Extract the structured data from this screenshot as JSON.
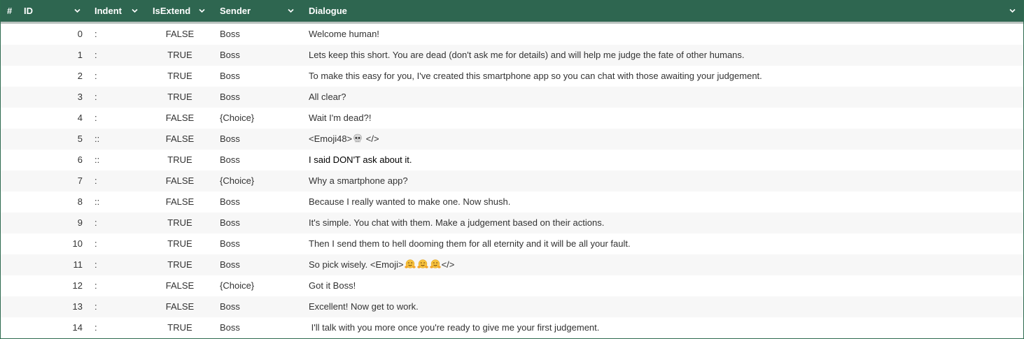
{
  "columns": {
    "rownum": "#",
    "id": "ID",
    "indent": "Indent",
    "is_extend": "IsExtend",
    "sender": "Sender",
    "dialogue": "Dialogue"
  },
  "colors": {
    "header_bg": "#2e6650",
    "header_text": "#ffffff",
    "row_alt_bg": "#f7f7f7",
    "text": "#333333"
  },
  "rows": [
    {
      "id": "0",
      "indent": ":",
      "is_extend": "FALSE",
      "sender": "Boss",
      "dialogue": "Welcome human!"
    },
    {
      "id": "1",
      "indent": ":",
      "is_extend": "TRUE",
      "sender": "Boss",
      "dialogue": "Lets keep this short. You are dead (don't ask me for details) and will help me judge the fate of other humans."
    },
    {
      "id": "2",
      "indent": ":",
      "is_extend": "TRUE",
      "sender": "Boss",
      "dialogue": "To make this easy for you, I've created this smartphone app so you can chat with those awaiting your judgement."
    },
    {
      "id": "3",
      "indent": ":",
      "is_extend": "TRUE",
      "sender": "Boss",
      "dialogue": "All clear?"
    },
    {
      "id": "4",
      "indent": ":",
      "is_extend": "FALSE",
      "sender": "{Choice}",
      "dialogue": "Wait I'm dead?!"
    },
    {
      "id": "5",
      "indent": "::",
      "is_extend": "FALSE",
      "sender": "Boss",
      "dialogue_pre": "<Emoji48>",
      "dialogue_emoji": "skull-emoji",
      "dialogue_post": "</>"
    },
    {
      "id": "6",
      "indent": "::",
      "is_extend": "TRUE",
      "sender": "Boss",
      "dialogue": "I said DON'T ask about it."
    },
    {
      "id": "7",
      "indent": ":",
      "is_extend": "FALSE",
      "sender": "{Choice}",
      "dialogue": "Why a smartphone app?"
    },
    {
      "id": "8",
      "indent": "::",
      "is_extend": "FALSE",
      "sender": "Boss",
      "dialogue": "Because I really wanted to make one. Now shush."
    },
    {
      "id": "9",
      "indent": ":",
      "is_extend": "TRUE",
      "sender": "Boss",
      "dialogue": "It's simple. You chat with them. Make a judgement based on their actions."
    },
    {
      "id": "10",
      "indent": ":",
      "is_extend": "TRUE",
      "sender": "Boss",
      "dialogue": "Then I send them to hell dooming them for all eternity and it will be all your fault."
    },
    {
      "id": "11",
      "indent": ":",
      "is_extend": "TRUE",
      "sender": "Boss",
      "dialogue_pre": "So pick wisely. <Emoji>",
      "dialogue_emoji": "hugging-face-emoji",
      "dialogue_post": "</>"
    },
    {
      "id": "12",
      "indent": ":",
      "is_extend": "FALSE",
      "sender": "{Choice}",
      "dialogue": "Got it Boss!"
    },
    {
      "id": "13",
      "indent": ":",
      "is_extend": "FALSE",
      "sender": "Boss",
      "dialogue": "Excellent! Now get to work."
    },
    {
      "id": "14",
      "indent": ":",
      "is_extend": "TRUE",
      "sender": "Boss",
      "dialogue": " I'll talk with you more once you're ready to give me your first judgement."
    }
  ]
}
